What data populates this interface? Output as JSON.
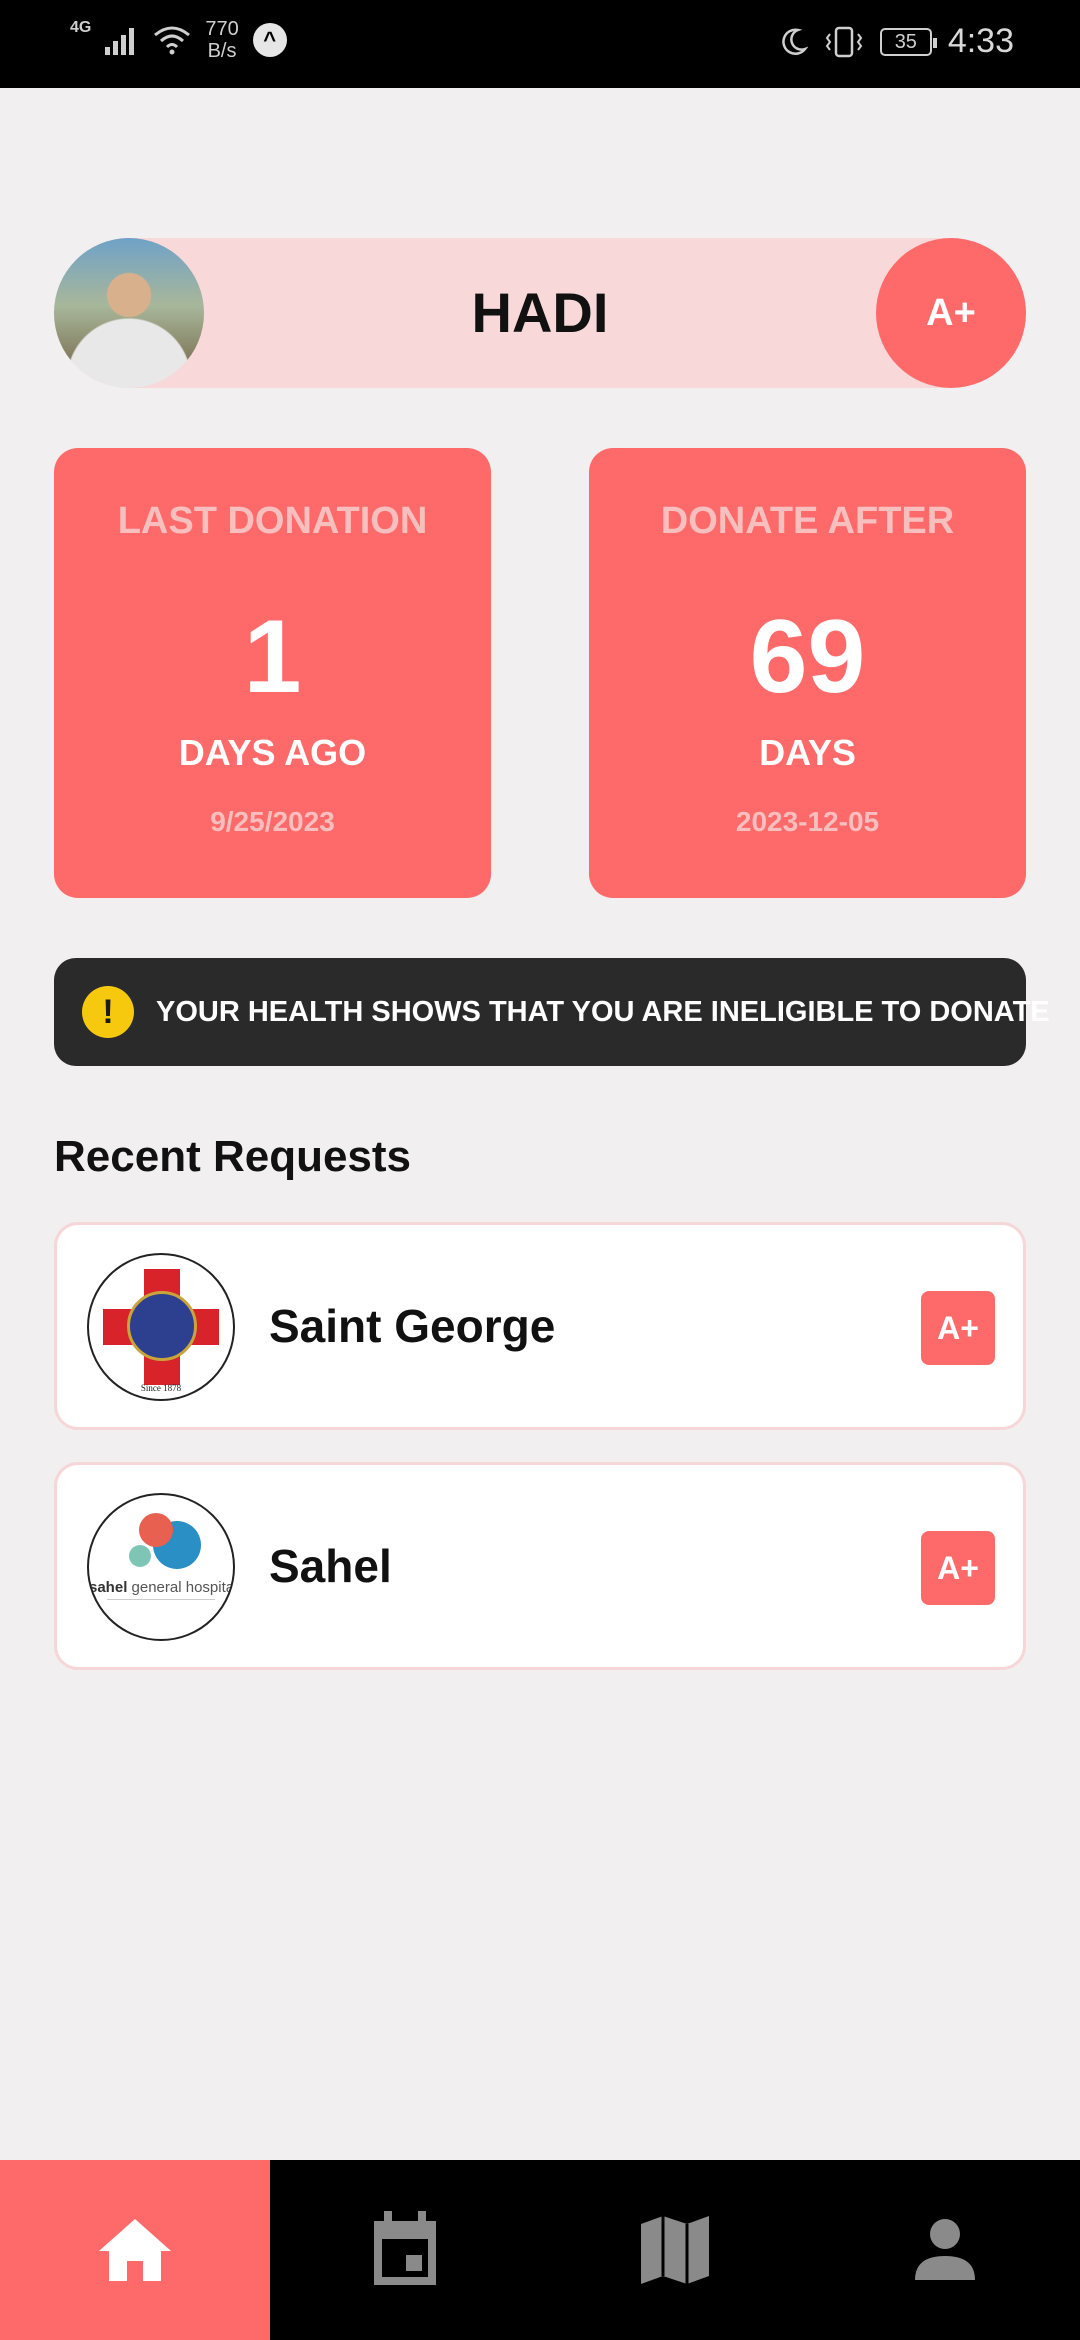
{
  "status_bar": {
    "network": "4G",
    "speed_value": "770",
    "speed_unit": "B/s",
    "battery": "35",
    "time": "4:33"
  },
  "profile": {
    "name": "HADI",
    "blood_type": "A+"
  },
  "last_donation": {
    "title": "LAST DONATION",
    "value": "1",
    "unit": "DAYS AGO",
    "date": "9/25/2023"
  },
  "donate_after": {
    "title": "DONATE AFTER",
    "value": "69",
    "unit": "DAYS",
    "date": "2023-12-05"
  },
  "warning": {
    "icon": "!",
    "text": "YOUR HEALTH SHOWS THAT YOU ARE INELIGIBLE TO DONATE"
  },
  "recent_requests": {
    "title": "Recent Requests",
    "items": [
      {
        "name": "Saint George",
        "blood_type": "A+",
        "logo_caption": "Since 1878"
      },
      {
        "name": "Sahel",
        "blood_type": "A+",
        "logo_text_bold": "sahel",
        "logo_text": " general hospital"
      }
    ]
  },
  "bottom_nav": {
    "items": [
      {
        "icon": "home-icon",
        "active": true
      },
      {
        "icon": "calendar-icon",
        "active": false
      },
      {
        "icon": "map-icon",
        "active": false
      },
      {
        "icon": "person-icon",
        "active": false
      }
    ]
  },
  "colors": {
    "accent": "#fe6a6a",
    "accent_light": "#f8d8d8",
    "background": "#f2eff0",
    "warning_bg": "#2a2a2a",
    "warning_icon": "#f6c90e"
  }
}
